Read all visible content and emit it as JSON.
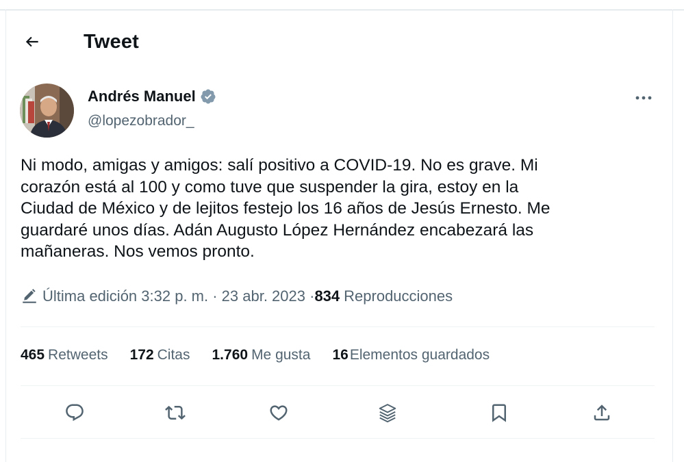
{
  "header": {
    "title": "Tweet"
  },
  "author": {
    "name": "Andrés Manuel",
    "handle": "@lopezobrador_"
  },
  "tweet": {
    "text": "Ni modo, amigas y amigos: salí positivo a COVID-19. No es grave. Mi\ncorazón está al 100 y como tuve que suspender la gira, estoy en la\nCiudad de México y de lejitos festejo los 16 años de Jesús Ernesto. Me\nguardaré unos días. Adán Augusto López Hernández encabezará las\nmañaneras. Nos vemos pronto."
  },
  "meta": {
    "edit_text": "Última edición 3:32 p. m. · 23 abr. 2023 · ",
    "views_count": "834",
    "views_label": "Reproducciones"
  },
  "stats": [
    {
      "num": "465",
      "label": "Retweets"
    },
    {
      "num": "172",
      "label": "Citas"
    },
    {
      "num": "1.760",
      "label": "Me gusta"
    },
    {
      "num": "16",
      "label": "Elementos guardados"
    }
  ],
  "icons": {
    "back": "arrow-left-icon",
    "verified": "verified-badge-icon",
    "more": "more-dots-icon",
    "edit": "pencil-icon",
    "reply": "reply-icon",
    "retweet": "retweet-icon",
    "like": "heart-icon",
    "stack": "stack-icon",
    "bookmark": "bookmark-icon",
    "share": "share-icon"
  },
  "colors": {
    "text": "#0f1419",
    "secondary": "#536471",
    "verified": "#829aab",
    "divider": "#eff3f4"
  }
}
